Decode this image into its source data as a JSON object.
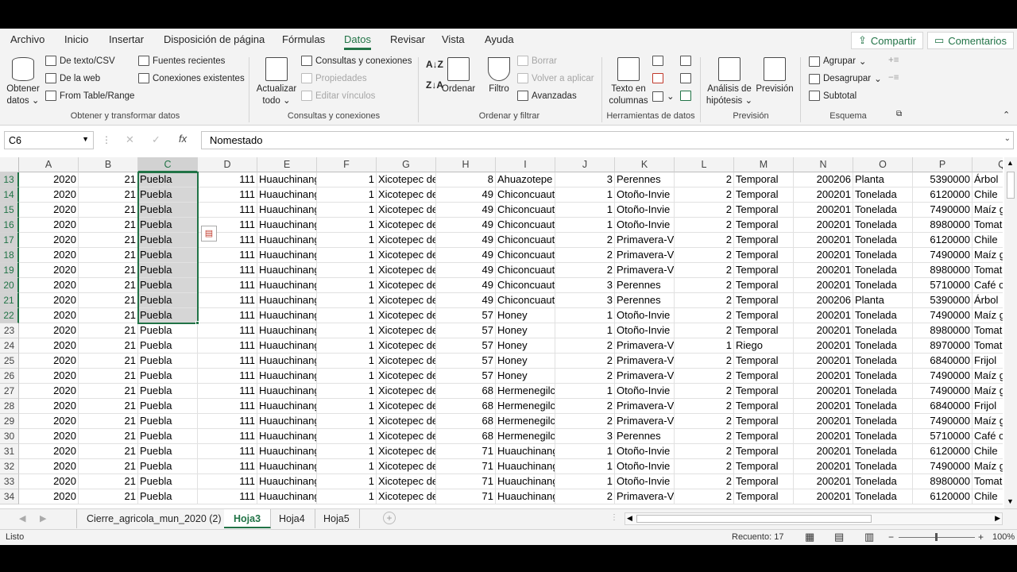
{
  "ribbon_tabs": [
    "Archivo",
    "Inicio",
    "Insertar",
    "Disposición de página",
    "Fórmulas",
    "Datos",
    "Revisar",
    "Vista",
    "Ayuda"
  ],
  "active_tab": "Datos",
  "share_label": "Compartir",
  "comments_label": "Comentarios",
  "ribbon": {
    "obtener_datos": "Obtener datos",
    "de_texto_csv": "De texto/CSV",
    "de_la_web": "De la web",
    "from_table": "From Table/Range",
    "fuentes_recientes": "Fuentes recientes",
    "conexiones_existentes": "Conexiones existentes",
    "group1": "Obtener y transformar datos",
    "actualizar_todo": "Actualizar todo",
    "consultas_conexiones": "Consultas y conexiones",
    "propiedades": "Propiedades",
    "editar_vinculos": "Editar vínculos",
    "group2": "Consultas y conexiones",
    "ordenar": "Ordenar",
    "filtro": "Filtro",
    "borrar": "Borrar",
    "volver_aplicar": "Volver a aplicar",
    "avanzadas": "Avanzadas",
    "group3": "Ordenar y filtrar",
    "texto_columnas": "Texto en columnas",
    "group4": "Herramientas de datos",
    "analisis": "Análisis de hipótesis",
    "prevision": "Previsión",
    "group5": "Previsión",
    "agrupar": "Agrupar",
    "desagrupar": "Desagrupar",
    "subtotal": "Subtotal",
    "group6": "Esquema"
  },
  "name_box": "C6",
  "formula": "Nomestado",
  "columns": [
    "A",
    "B",
    "C",
    "D",
    "E",
    "F",
    "G",
    "H",
    "I",
    "J",
    "K",
    "L",
    "M",
    "N",
    "O",
    "P",
    "Q"
  ],
  "selected_column": "C",
  "rows": [
    {
      "n": "13",
      "c": [
        "2020",
        "21",
        "Puebla",
        "111",
        "Huauchinang",
        "1",
        "Xicotepec de",
        "8",
        "Ahuazotepe",
        "3",
        "Perennes",
        "2",
        "Temporal",
        "200206",
        "Planta",
        "5390000",
        "Árbol"
      ]
    },
    {
      "n": "14",
      "c": [
        "2020",
        "21",
        "Puebla",
        "111",
        "Huauchinang",
        "1",
        "Xicotepec de",
        "49",
        "Chiconcuaut",
        "1",
        "Otoño-Invie",
        "2",
        "Temporal",
        "200201",
        "Tonelada",
        "6120000",
        "Chile"
      ]
    },
    {
      "n": "15",
      "c": [
        "2020",
        "21",
        "Puebla",
        "111",
        "Huauchinang",
        "1",
        "Xicotepec de",
        "49",
        "Chiconcuaut",
        "1",
        "Otoño-Invie",
        "2",
        "Temporal",
        "200201",
        "Tonelada",
        "7490000",
        "Maíz g"
      ]
    },
    {
      "n": "16",
      "c": [
        "2020",
        "21",
        "Puebla",
        "111",
        "Huauchinang",
        "1",
        "Xicotepec de",
        "49",
        "Chiconcuaut",
        "1",
        "Otoño-Invie",
        "2",
        "Temporal",
        "200201",
        "Tonelada",
        "8980000",
        "Tomat"
      ]
    },
    {
      "n": "17",
      "c": [
        "2020",
        "21",
        "Puebla",
        "111",
        "Huauchinang",
        "1",
        "Xicotepec de",
        "49",
        "Chiconcuaut",
        "2",
        "Primavera-V",
        "2",
        "Temporal",
        "200201",
        "Tonelada",
        "6120000",
        "Chile"
      ]
    },
    {
      "n": "18",
      "c": [
        "2020",
        "21",
        "Puebla",
        "111",
        "Huauchinang",
        "1",
        "Xicotepec de",
        "49",
        "Chiconcuaut",
        "2",
        "Primavera-V",
        "2",
        "Temporal",
        "200201",
        "Tonelada",
        "7490000",
        "Maíz g"
      ]
    },
    {
      "n": "19",
      "c": [
        "2020",
        "21",
        "Puebla",
        "111",
        "Huauchinang",
        "1",
        "Xicotepec de",
        "49",
        "Chiconcuaut",
        "2",
        "Primavera-V",
        "2",
        "Temporal",
        "200201",
        "Tonelada",
        "8980000",
        "Tomat"
      ]
    },
    {
      "n": "20",
      "c": [
        "2020",
        "21",
        "Puebla",
        "111",
        "Huauchinang",
        "1",
        "Xicotepec de",
        "49",
        "Chiconcuaut",
        "3",
        "Perennes",
        "2",
        "Temporal",
        "200201",
        "Tonelada",
        "5710000",
        "Café c"
      ]
    },
    {
      "n": "21",
      "c": [
        "2020",
        "21",
        "Puebla",
        "111",
        "Huauchinang",
        "1",
        "Xicotepec de",
        "49",
        "Chiconcuaut",
        "3",
        "Perennes",
        "2",
        "Temporal",
        "200206",
        "Planta",
        "5390000",
        "Árbol"
      ]
    },
    {
      "n": "22",
      "c": [
        "2020",
        "21",
        "Puebla",
        "111",
        "Huauchinang",
        "1",
        "Xicotepec de",
        "57",
        "Honey",
        "1",
        "Otoño-Invie",
        "2",
        "Temporal",
        "200201",
        "Tonelada",
        "7490000",
        "Maíz g"
      ]
    },
    {
      "n": "23",
      "c": [
        "2020",
        "21",
        "Puebla",
        "111",
        "Huauchinang",
        "1",
        "Xicotepec de",
        "57",
        "Honey",
        "1",
        "Otoño-Invie",
        "2",
        "Temporal",
        "200201",
        "Tonelada",
        "8980000",
        "Tomat"
      ]
    },
    {
      "n": "24",
      "c": [
        "2020",
        "21",
        "Puebla",
        "111",
        "Huauchinang",
        "1",
        "Xicotepec de",
        "57",
        "Honey",
        "2",
        "Primavera-V",
        "1",
        "Riego",
        "200201",
        "Tonelada",
        "8970000",
        "Tomat"
      ]
    },
    {
      "n": "25",
      "c": [
        "2020",
        "21",
        "Puebla",
        "111",
        "Huauchinang",
        "1",
        "Xicotepec de",
        "57",
        "Honey",
        "2",
        "Primavera-V",
        "2",
        "Temporal",
        "200201",
        "Tonelada",
        "6840000",
        "Frijol"
      ]
    },
    {
      "n": "26",
      "c": [
        "2020",
        "21",
        "Puebla",
        "111",
        "Huauchinang",
        "1",
        "Xicotepec de",
        "57",
        "Honey",
        "2",
        "Primavera-V",
        "2",
        "Temporal",
        "200201",
        "Tonelada",
        "7490000",
        "Maíz g"
      ]
    },
    {
      "n": "27",
      "c": [
        "2020",
        "21",
        "Puebla",
        "111",
        "Huauchinang",
        "1",
        "Xicotepec de",
        "68",
        "Hermenegilc",
        "1",
        "Otoño-Invie",
        "2",
        "Temporal",
        "200201",
        "Tonelada",
        "7490000",
        "Maíz g"
      ]
    },
    {
      "n": "28",
      "c": [
        "2020",
        "21",
        "Puebla",
        "111",
        "Huauchinang",
        "1",
        "Xicotepec de",
        "68",
        "Hermenegilc",
        "2",
        "Primavera-V",
        "2",
        "Temporal",
        "200201",
        "Tonelada",
        "6840000",
        "Frijol"
      ]
    },
    {
      "n": "29",
      "c": [
        "2020",
        "21",
        "Puebla",
        "111",
        "Huauchinang",
        "1",
        "Xicotepec de",
        "68",
        "Hermenegilc",
        "2",
        "Primavera-V",
        "2",
        "Temporal",
        "200201",
        "Tonelada",
        "7490000",
        "Maíz g"
      ]
    },
    {
      "n": "30",
      "c": [
        "2020",
        "21",
        "Puebla",
        "111",
        "Huauchinang",
        "1",
        "Xicotepec de",
        "68",
        "Hermenegilc",
        "3",
        "Perennes",
        "2",
        "Temporal",
        "200201",
        "Tonelada",
        "5710000",
        "Café c"
      ]
    },
    {
      "n": "31",
      "c": [
        "2020",
        "21",
        "Puebla",
        "111",
        "Huauchinang",
        "1",
        "Xicotepec de",
        "71",
        "Huauchinang",
        "1",
        "Otoño-Invie",
        "2",
        "Temporal",
        "200201",
        "Tonelada",
        "6120000",
        "Chile"
      ]
    },
    {
      "n": "32",
      "c": [
        "2020",
        "21",
        "Puebla",
        "111",
        "Huauchinang",
        "1",
        "Xicotepec de",
        "71",
        "Huauchinang",
        "1",
        "Otoño-Invie",
        "2",
        "Temporal",
        "200201",
        "Tonelada",
        "7490000",
        "Maíz g"
      ]
    },
    {
      "n": "33",
      "c": [
        "2020",
        "21",
        "Puebla",
        "111",
        "Huauchinang",
        "1",
        "Xicotepec de",
        "71",
        "Huauchinang",
        "1",
        "Otoño-Invie",
        "2",
        "Temporal",
        "200201",
        "Tonelada",
        "8980000",
        "Tomat"
      ]
    },
    {
      "n": "34",
      "c": [
        "2020",
        "21",
        "Puebla",
        "111",
        "Huauchinang",
        "1",
        "Xicotepec de",
        "71",
        "Huauchinang",
        "2",
        "Primavera-V",
        "2",
        "Temporal",
        "200201",
        "Tonelada",
        "6120000",
        "Chile"
      ]
    }
  ],
  "sheets": [
    "Cierre_agricola_mun_2020 (2)",
    "Hoja3",
    "Hoja4",
    "Hoja5"
  ],
  "active_sheet": "Hoja3",
  "status": {
    "ready": "Listo",
    "count": "Recuento: 17",
    "zoom": "100%"
  }
}
